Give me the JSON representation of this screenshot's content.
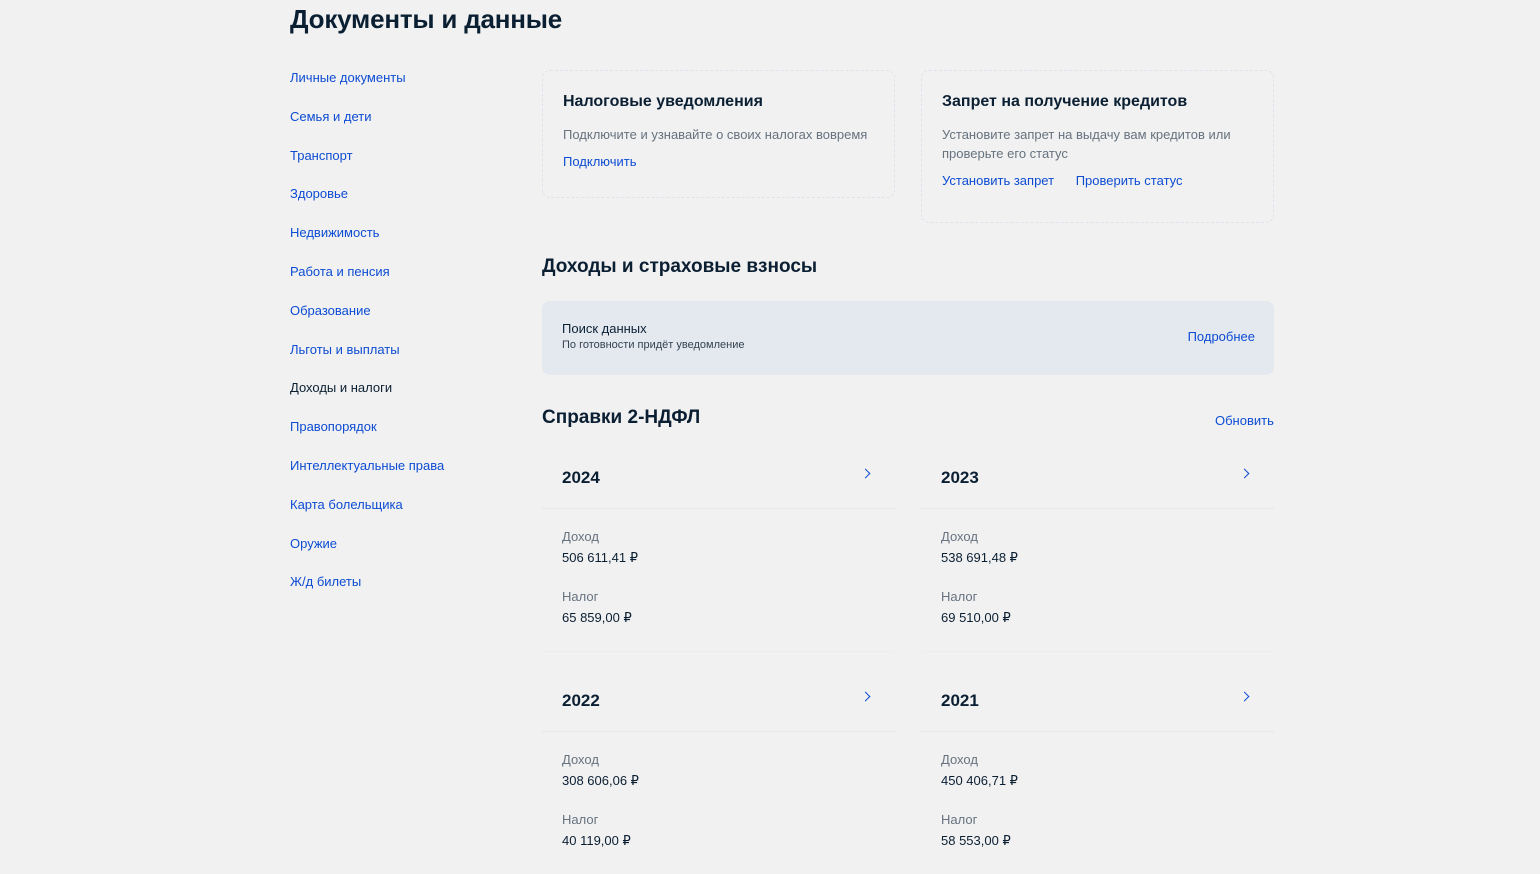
{
  "page": {
    "title": "Документы и данные"
  },
  "sidebar": {
    "items": [
      {
        "label": "Личные документы"
      },
      {
        "label": "Семья и дети"
      },
      {
        "label": "Транспорт"
      },
      {
        "label": "Здоровье"
      },
      {
        "label": "Недвижимость"
      },
      {
        "label": "Работа и пенсия"
      },
      {
        "label": "Образование"
      },
      {
        "label": "Льготы и выплаты"
      },
      {
        "label": "Доходы и налоги",
        "active": true
      },
      {
        "label": "Правопорядок"
      },
      {
        "label": "Интеллектуальные права"
      },
      {
        "label": "Карта болельщика"
      },
      {
        "label": "Оружие"
      },
      {
        "label": "Ж/д билеты"
      }
    ]
  },
  "tax_card": {
    "title": "Налоговые уведомления",
    "description": "Подключите и узнавайте о своих налогах вовремя",
    "link": "Подключить"
  },
  "credit_card": {
    "title": "Запрет на получение кредитов",
    "description": "Установите запрет на выдачу вам кредитов или проверьте его статус",
    "link_set": "Установить запрет",
    "link_check": "Проверить статус"
  },
  "income_section": {
    "title": "Доходы и страховые взносы",
    "status_title": "Поиск данных",
    "status_sub": "По готовности придёт уведомление",
    "details_link": "Подробнее"
  },
  "ndfl_section": {
    "title": "Справки 2-НДФЛ",
    "refresh_link": "Обновить",
    "income_label": "Доход",
    "tax_label": "Налог",
    "years": [
      {
        "year": "2024",
        "income": "506 611,41 ₽",
        "tax": "65 859,00 ₽"
      },
      {
        "year": "2023",
        "income": "538 691,48 ₽",
        "tax": "69 510,00 ₽"
      },
      {
        "year": "2022",
        "income": "308 606,06 ₽",
        "tax": "40 119,00 ₽"
      },
      {
        "year": "2021",
        "income": "450 406,71 ₽",
        "tax": "58 553,00 ₽"
      }
    ]
  },
  "colors": {
    "link": "#0d4cd3",
    "text": "#0b1f33",
    "muted": "#66727f",
    "panel": "#e4e9f0",
    "background": "#f1f1f1"
  }
}
